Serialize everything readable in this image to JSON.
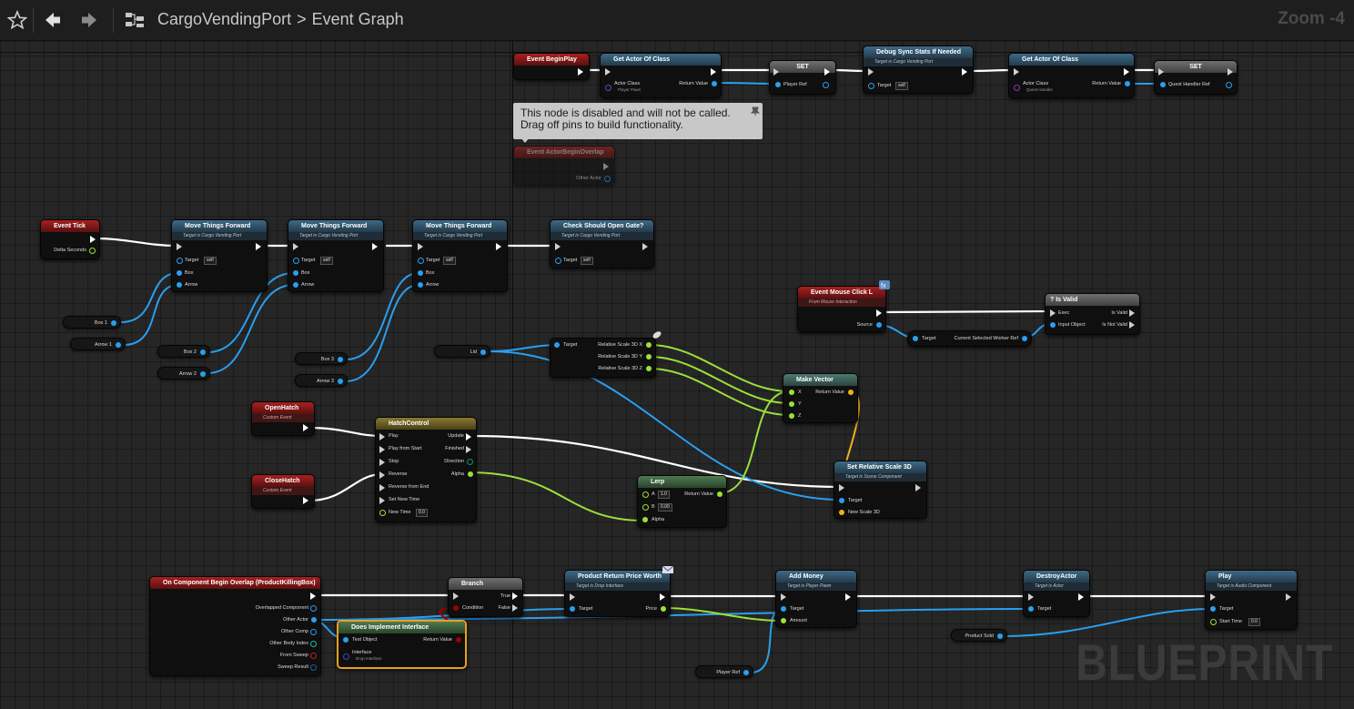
{
  "toolbar": {
    "star_icon": "star-icon",
    "back_icon": "back-arrow-icon",
    "forward_icon": "forward-arrow-icon",
    "graph_icon": "graph-icon",
    "breadcrumb_root": "CargoVendingPort",
    "breadcrumb_sep": ">",
    "breadcrumb_current": "Event Graph",
    "zoom": "Zoom -4"
  },
  "tooltip": {
    "text1": "This node is disabled and will not be called.",
    "text2": "Drag off pins to build functionality."
  },
  "watermark": "BLUEPRINT",
  "nodes": {
    "begin_play": {
      "title": "Event BeginPlay"
    },
    "get_actor1": {
      "title": "Get Actor Of Class",
      "actor_class": "Actor Class",
      "actor_class_value": "Player Pawn",
      "return": "Return Value"
    },
    "set1": {
      "title": "SET",
      "pin": "Player Ref"
    },
    "debug_sync": {
      "title": "Debug Sync Stats If Needed",
      "sub": "Target is Cargo Vending Port",
      "target": "Target",
      "self": "self"
    },
    "get_actor2": {
      "title": "Get Actor Of Class",
      "actor_class": "Actor Class",
      "actor_class_value": "Quest Handler",
      "return": "Return Value"
    },
    "set2": {
      "title": "SET",
      "pin": "Quest Handler Ref"
    },
    "begin_overlap": {
      "title": "Event ActorBeginOverlap",
      "pin": "Other Actor"
    },
    "event_tick": {
      "title": "Event Tick",
      "pin": "Delta Seconds"
    },
    "move1": {
      "title": "Move Things Forward",
      "sub": "Target is Cargo Vending Port",
      "target": "Target",
      "self": "self",
      "box": "Box",
      "arrow": "Arrow"
    },
    "move2": {
      "title": "Move Things Forward",
      "sub": "Target is Cargo Vending Port",
      "target": "Target",
      "self": "self",
      "box": "Box",
      "arrow": "Arrow"
    },
    "move3": {
      "title": "Move Things Forward",
      "sub": "Target is Cargo Vending Port",
      "target": "Target",
      "self": "self",
      "box": "Box",
      "arrow": "Arrow"
    },
    "check_gate": {
      "title": "Check Should Open Gate?",
      "sub": "Target is Cargo Vending Port",
      "target": "Target",
      "self": "self"
    },
    "mouse_click": {
      "title": "Event Mouse Click L",
      "sub": "From Mouse Interaction",
      "source": "Source"
    },
    "is_valid": {
      "title": "? Is Valid",
      "exec": "Exec",
      "input": "Input Object",
      "valid": "Is Valid",
      "not_valid": "Is Not Valid"
    },
    "current_worker": {
      "target": "Target",
      "out": "Current Selected Worker Ref"
    },
    "scale_breaker": {
      "target": "Target",
      "x": "Relative Scale 3D X",
      "y": "Relative Scale 3D Y",
      "z": "Relative Scale 3D Z"
    },
    "make_vector": {
      "title": "Make Vector",
      "x": "X",
      "y": "Y",
      "z": "Z",
      "return": "Return Value"
    },
    "open_hatch": {
      "title": "OpenHatch",
      "sub": "Custom Event"
    },
    "close_hatch": {
      "title": "CloseHatch",
      "sub": "Custom Event"
    },
    "hatch_control": {
      "title": "HatchControl",
      "pins_in": [
        "Play",
        "Play from Start",
        "Stop",
        "Reverse",
        "Reverse from End",
        "Set New Time",
        "New Time"
      ],
      "new_time": "0.0",
      "pins_out": [
        "Update",
        "Finished",
        "Direction",
        "Alpha"
      ]
    },
    "lerp": {
      "title": "Lerp",
      "a": "A",
      "a_val": "1.0",
      "b": "B",
      "b_val": "0.00",
      "alpha": "Alpha",
      "return": "Return Value"
    },
    "set_scale": {
      "title": "Set Relative Scale 3D",
      "sub": "Target is Scene Component",
      "target": "Target",
      "new_scale": "New Scale 3D"
    },
    "comp_overlap": {
      "title": "On Component Begin Overlap (ProductKillingBox)",
      "pins": [
        "Overlapped Component",
        "Other Actor",
        "Other Comp",
        "Other Body Index",
        "From Sweep",
        "Sweep Result"
      ]
    },
    "branch": {
      "title": "Branch",
      "condition": "Condition",
      "true": "True",
      "false": "False"
    },
    "implements": {
      "title": "Does Implement Interface",
      "test": "Test Object",
      "interface": "Interface",
      "interface_val": "Drop Interface",
      "return": "Return Value"
    },
    "price_worth": {
      "title": "Product Return Price Worth",
      "sub": "Target is Drop Interface",
      "target": "Target",
      "price": "Price"
    },
    "add_money": {
      "title": "Add Money",
      "sub": "Target is Player Pawn",
      "target": "Target",
      "amount": "Amount"
    },
    "destroy": {
      "title": "DestroyActor",
      "sub": "Target is Actor",
      "target": "Target"
    },
    "play": {
      "title": "Play",
      "sub": "Target is Audio Component",
      "target": "Target",
      "start": "Start Time",
      "start_val": "0.0"
    }
  },
  "variables": {
    "box1": "Box 1",
    "arrow1": "Arrow 1",
    "box2": "Box 2",
    "arrow2": "Arrow 2",
    "box3": "Box 3",
    "arrow3": "Arrow 3",
    "lid": "Lid",
    "product_sold": "Product Sold",
    "player_ref": "Player Ref"
  },
  "colors": {
    "exec": "#ffffff",
    "object": "#2a9ff0",
    "float": "#9be03a",
    "vector": "#f0b020",
    "bool": "#a00000",
    "struct": "#1a5fa8",
    "event_header": "#a82020",
    "function_header": "#3e6a86"
  }
}
